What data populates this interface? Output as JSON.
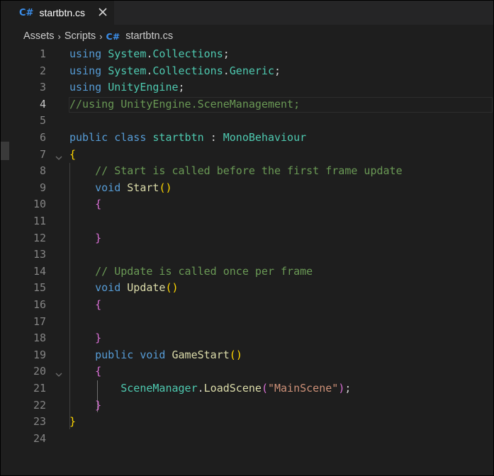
{
  "tab": {
    "lang_badge": "C#",
    "file_name": "startbtn.cs"
  },
  "breadcrumb": {
    "items": [
      "Assets",
      "Scripts"
    ],
    "lang_badge": "C#",
    "file_name": "startbtn.cs"
  },
  "editor": {
    "active_line": 4,
    "code_lines": [
      "using System.Collections;",
      "using System.Collections.Generic;",
      "using UnityEngine;",
      "//using UnityEngine.SceneManagement;",
      "",
      "public class startbtn : MonoBehaviour",
      "{",
      "    // Start is called before the first frame update",
      "    void Start()",
      "    {",
      "",
      "    }",
      "",
      "    // Update is called once per frame",
      "    void Update()",
      "    {",
      "",
      "    }",
      "    public void GameStart()",
      "    {",
      "        SceneManager.LoadScene(\"MainScene\");",
      "    }",
      "}",
      ""
    ],
    "line_numbers": [
      "1",
      "2",
      "3",
      "4",
      "5",
      "6",
      "7",
      "8",
      "9",
      "10",
      "11",
      "12",
      "13",
      "14",
      "15",
      "16",
      "17",
      "18",
      "19",
      "20",
      "21",
      "22",
      "23",
      "24"
    ]
  },
  "colors": {
    "keyword": "#569cd6",
    "type": "#4ec9b0",
    "comment": "#6a9955",
    "function": "#dcdcaa",
    "string": "#ce9178",
    "plain": "#d4d4d4",
    "bracket_level1": "#ffd700",
    "bracket_level2": "#da70d6",
    "csharp_badge": "#3b8eea"
  }
}
